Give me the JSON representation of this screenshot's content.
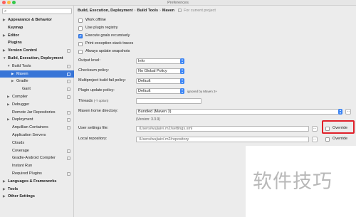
{
  "window": {
    "title": "Preferences"
  },
  "sidebar": {
    "search_placeholder": "",
    "items": [
      {
        "label": "Appearance & Behavior",
        "level": 0,
        "bold": true,
        "arrow": "right"
      },
      {
        "label": "Keymap",
        "level": 0,
        "bold": true,
        "arrow": ""
      },
      {
        "label": "Editor",
        "level": 0,
        "bold": true,
        "arrow": "right"
      },
      {
        "label": "Plugins",
        "level": 0,
        "bold": true,
        "arrow": ""
      },
      {
        "label": "Version Control",
        "level": 0,
        "bold": true,
        "arrow": "right",
        "copy": true
      },
      {
        "label": "Build, Execution, Deployment",
        "level": 0,
        "bold": true,
        "arrow": "down"
      },
      {
        "label": "Build Tools",
        "level": 1,
        "arrow": "down",
        "copy": true
      },
      {
        "label": "Maven",
        "level": 2,
        "arrow": "right",
        "selected": true,
        "copy": true
      },
      {
        "label": "Gradle",
        "level": 2,
        "arrow": "right",
        "copy": true
      },
      {
        "label": "Gant",
        "level": 3,
        "arrow": "",
        "copy": true
      },
      {
        "label": "Compiler",
        "level": 1,
        "arrow": "right",
        "copy": true
      },
      {
        "label": "Debugger",
        "level": 1,
        "arrow": "right"
      },
      {
        "label": "Remote Jar Repositories",
        "level": 1,
        "arrow": "",
        "copy": true
      },
      {
        "label": "Deployment",
        "level": 1,
        "arrow": "right",
        "copy": true
      },
      {
        "label": "Arquillian Containers",
        "level": 1,
        "arrow": "",
        "copy": true
      },
      {
        "label": "Application Servers",
        "level": 1,
        "arrow": ""
      },
      {
        "label": "Clouds",
        "level": 1,
        "arrow": ""
      },
      {
        "label": "Coverage",
        "level": 1,
        "arrow": "",
        "copy": true
      },
      {
        "label": "Gradle-Android Compiler",
        "level": 1,
        "arrow": "",
        "copy": true
      },
      {
        "label": "Instant Run",
        "level": 1,
        "arrow": ""
      },
      {
        "label": "Required Plugins",
        "level": 1,
        "arrow": "",
        "copy": true
      },
      {
        "label": "Languages & Frameworks",
        "level": 0,
        "bold": true,
        "arrow": "right"
      },
      {
        "label": "Tools",
        "level": 0,
        "bold": true,
        "arrow": "right"
      },
      {
        "label": "Other Settings",
        "level": 0,
        "bold": true,
        "arrow": "right"
      }
    ]
  },
  "breadcrumb": {
    "part1": "Build, Execution, Deployment",
    "sep": "›",
    "part2": "Build Tools",
    "part3": "Maven",
    "note": "For current project"
  },
  "checkboxes": [
    {
      "label": "Work offline",
      "checked": false
    },
    {
      "label": "Use plugin registry",
      "checked": false
    },
    {
      "label": "Execute goals recursively",
      "checked": true
    },
    {
      "label": "Print exception stack traces",
      "checked": false
    },
    {
      "label": "Always update snapshots",
      "checked": false
    }
  ],
  "fields": {
    "output_level": {
      "label": "Output level:",
      "value": "Info"
    },
    "checksum_policy": {
      "label": "Checksum policy:",
      "value": "No Global Policy"
    },
    "fail_policy": {
      "label": "Multiproject build fail policy:",
      "value": "Default"
    },
    "plugin_update": {
      "label": "Plugin update policy:",
      "value": "Default",
      "hint": "ignored by Maven 3+"
    },
    "threads": {
      "label": "Threads",
      "hint": "(-T option)",
      "value": ""
    },
    "maven_home": {
      "label": "Maven home directory:",
      "value": "Bundled (Maven 3)",
      "version": "(Version: 3.3.9)"
    },
    "user_settings": {
      "label": "User settings file:",
      "value": "/Users/wujiaiv/.m2/settings.xml",
      "override": "Override",
      "override_checked": false
    },
    "local_repo": {
      "label": "Local repository:",
      "value": "/Users/wujiaiv/.m2/repository",
      "override": "Override",
      "override_checked": false
    }
  },
  "browse_label": "...",
  "watermark": "软件技巧"
}
